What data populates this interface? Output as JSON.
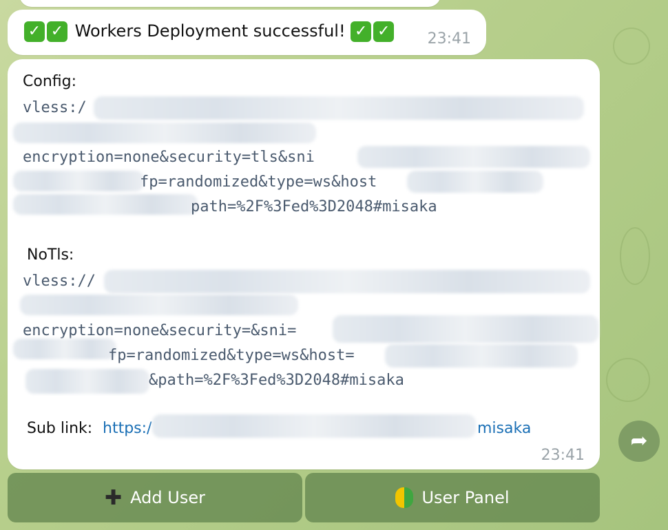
{
  "message1": {
    "text": "Workers Deployment successful!",
    "time": "23:41"
  },
  "message2": {
    "config_heading": "Config:",
    "config_lines": [
      "vless:/",
      "encryption=none&security=tls&sni",
      "fp=randomized&type=ws&host",
      "path=%2F%3Fed%3D2048#misaka"
    ],
    "notls_heading": "NoTls:",
    "notls_lines": [
      "vless://",
      "encryption=none&security=&sni=",
      "fp=randomized&type=ws&host=",
      "&path=%2F%3Fed%3D2048#misaka"
    ],
    "sub_label": "Sub link:",
    "sub_link_start": "https:/",
    "sub_link_end": "misaka",
    "time": "23:41"
  },
  "keyboard": {
    "add_user": "Add User",
    "user_panel": "User Panel"
  },
  "icons": {
    "check": "check-mark-button",
    "forward": "share-arrow",
    "plus": "heavy-plus",
    "beginner": "japanese-beginner-symbol"
  }
}
